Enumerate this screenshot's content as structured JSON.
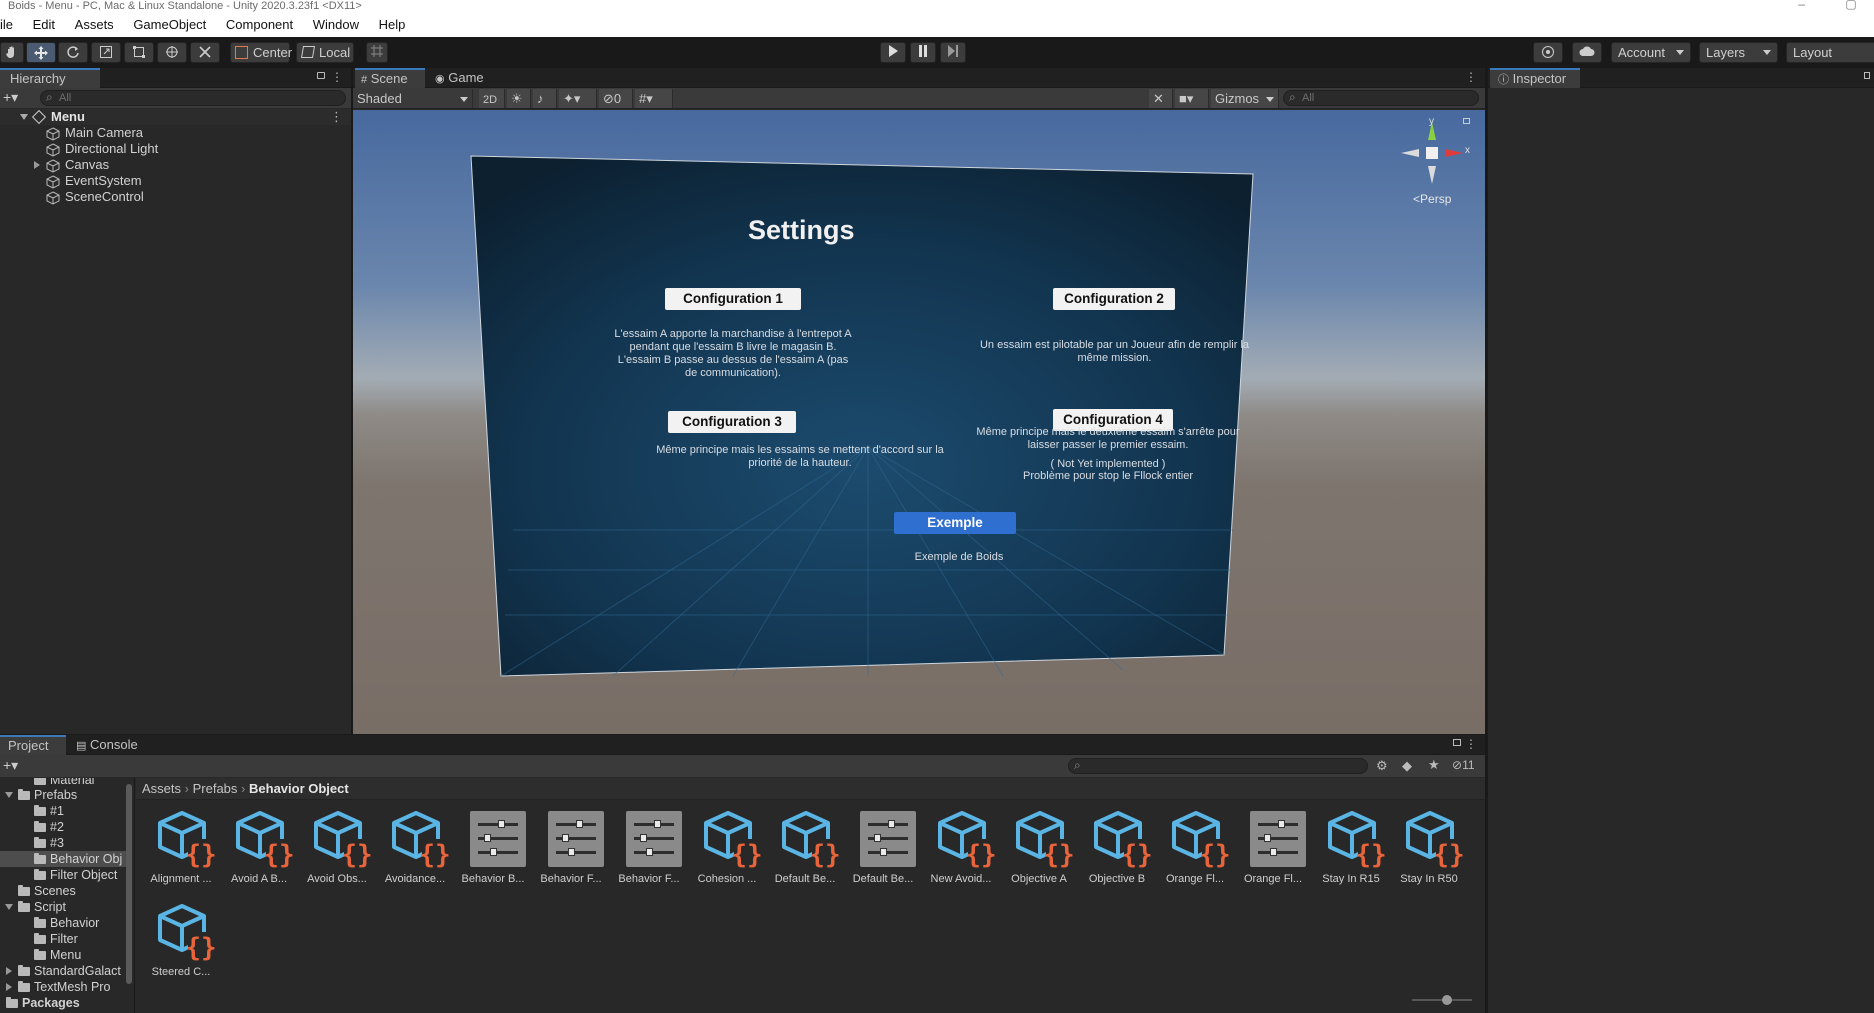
{
  "window": {
    "title": "Boids - Menu - PC, Mac & Linux Standalone - Unity 2020.3.23f1 <DX11>",
    "buttons": [
      "–",
      "▢"
    ]
  },
  "menubar": [
    "ile",
    "Edit",
    "Assets",
    "GameObject",
    "Component",
    "Window",
    "Help"
  ],
  "toolbar": {
    "pivot_label": "Center",
    "space_label": "Local",
    "account_label": "Account",
    "layers_label": "Layers",
    "layout_label": "Layout"
  },
  "hierarchy": {
    "tab": "Hierarchy",
    "search_placeholder": "All",
    "scene": "Menu",
    "items": [
      "Main Camera",
      "Directional Light",
      "Canvas",
      "EventSystem",
      "SceneControl"
    ]
  },
  "scene": {
    "tabs": [
      "Scene",
      "Game"
    ],
    "shading": "Shaded",
    "mode_2d": "2D",
    "hidden_count": "0",
    "gizmos": "Gizmos",
    "search_placeholder": "All",
    "persp_label": "Persp",
    "axis_labels": {
      "y": "y",
      "x": "x"
    },
    "canvas": {
      "title": "Settings",
      "config1": "Configuration 1",
      "config1_text": "L'essaim A apporte la marchandise à l'entrepot A pendant que l'essaim B livre le magasin B. L'essaim B passe au dessus de l'essaim A (pas de communication).",
      "config2": "Configuration 2",
      "config2_text": "Un essaim est pilotable par un Joueur afin de remplir la même mission.",
      "config3": "Configuration 3",
      "config3_text": "Même principe mais les essaims se mettent d'accord sur la priorité de la hauteur.",
      "config4": "Configuration 4",
      "config4_text": "Même principe mais le deuxième essaim s'arrête pour laisser passer le premier essaim.",
      "config4_note1": "( Not Yet implemented )",
      "config4_note2": "Problème pour stop le Fllock entier",
      "example": "Exemple",
      "example_text": "Exemple de Boids"
    }
  },
  "inspector": {
    "tab": "Inspector"
  },
  "project": {
    "tabs": [
      "Project",
      "Console"
    ],
    "hidden_count": "11",
    "breadcrumb": [
      "Assets",
      "Prefabs",
      "Behavior Object"
    ],
    "tree": [
      {
        "label": "Material",
        "indent": 2,
        "kind": "folder"
      },
      {
        "label": "Prefabs",
        "indent": 1,
        "kind": "folder",
        "open": true
      },
      {
        "label": "#1",
        "indent": 2,
        "kind": "folder"
      },
      {
        "label": "#2",
        "indent": 2,
        "kind": "folder"
      },
      {
        "label": "#3",
        "indent": 2,
        "kind": "folder"
      },
      {
        "label": "Behavior Obj",
        "indent": 2,
        "kind": "folder",
        "selected": true
      },
      {
        "label": "Filter Object",
        "indent": 2,
        "kind": "folder"
      },
      {
        "label": "Scenes",
        "indent": 1,
        "kind": "folder"
      },
      {
        "label": "Script",
        "indent": 1,
        "kind": "folder",
        "open": true
      },
      {
        "label": "Behavior",
        "indent": 2,
        "kind": "folder"
      },
      {
        "label": "Filter",
        "indent": 2,
        "kind": "folder"
      },
      {
        "label": "Menu",
        "indent": 2,
        "kind": "folder"
      },
      {
        "label": "StandardGalact",
        "indent": 1,
        "kind": "folder",
        "collapsed": true
      },
      {
        "label": "TextMesh Pro",
        "indent": 1,
        "kind": "folder",
        "collapsed": true
      },
      {
        "label": "Packages",
        "indent": 0,
        "kind": "folder",
        "collapsed": true,
        "bold": true
      }
    ],
    "assets": [
      {
        "label": "Alignment ...",
        "type": "script"
      },
      {
        "label": "Avoid A B...",
        "type": "script"
      },
      {
        "label": "Avoid Obs...",
        "type": "script"
      },
      {
        "label": "Avoidance...",
        "type": "script"
      },
      {
        "label": "Behavior B...",
        "type": "settings"
      },
      {
        "label": "Behavior F...",
        "type": "settings"
      },
      {
        "label": "Behavior F...",
        "type": "settings"
      },
      {
        "label": "Cohesion ...",
        "type": "script"
      },
      {
        "label": "Default Be...",
        "type": "script"
      },
      {
        "label": "Default Be...",
        "type": "settings"
      },
      {
        "label": "New Avoid...",
        "type": "script"
      },
      {
        "label": "Objective A",
        "type": "script"
      },
      {
        "label": "Objective B",
        "type": "script"
      },
      {
        "label": "Orange Fl...",
        "type": "script"
      },
      {
        "label": "Orange Fl...",
        "type": "settings"
      },
      {
        "label": "Stay In R15",
        "type": "script"
      },
      {
        "label": "Stay In R50",
        "type": "script"
      },
      {
        "label": "Steered C...",
        "type": "script"
      }
    ]
  },
  "colors": {
    "accent": "#3a79bb",
    "script_cube": "#5ab5e4",
    "script_braces": "#e8643a",
    "canvas_button_blue": "#2f6fd0"
  }
}
